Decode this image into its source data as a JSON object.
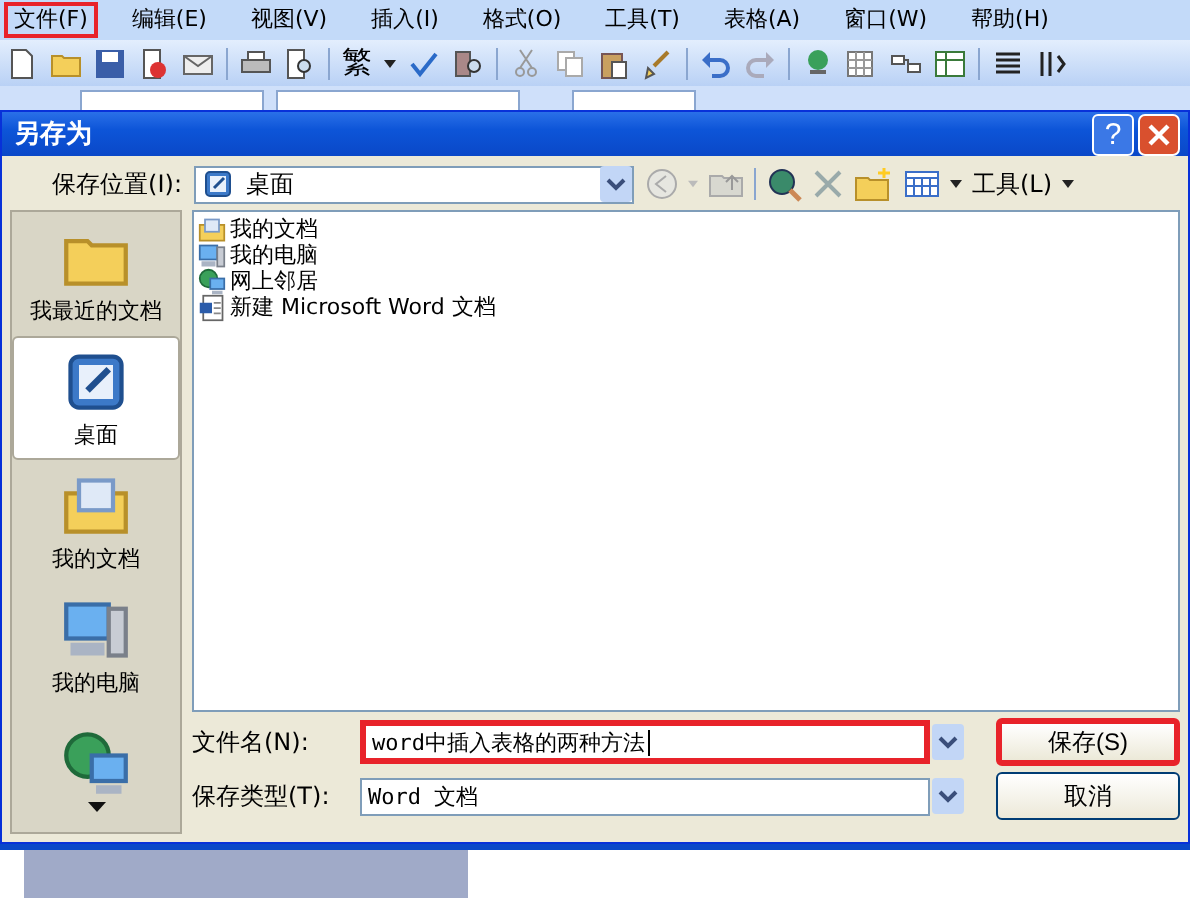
{
  "menu_bar": [
    {
      "label": "文件(F)",
      "highlighted": true
    },
    {
      "label": "编辑(E)",
      "highlighted": false
    },
    {
      "label": "视图(V)",
      "highlighted": false
    },
    {
      "label": "插入(I)",
      "highlighted": false
    },
    {
      "label": "格式(O)",
      "highlighted": false
    },
    {
      "label": "工具(T)",
      "highlighted": false
    },
    {
      "label": "表格(A)",
      "highlighted": false
    },
    {
      "label": "窗口(W)",
      "highlighted": false
    },
    {
      "label": "帮助(H)",
      "highlighted": false
    }
  ],
  "toolbar": {
    "traditional_button": "繁"
  },
  "dialog": {
    "title": "另存为",
    "help_button": "?",
    "save_in": {
      "label": "保存位置(I):",
      "value": "桌面"
    },
    "tools_menu": "工具(L)",
    "places": [
      {
        "label": "我最近的文档",
        "kind": "recent",
        "selected": false
      },
      {
        "label": "桌面",
        "kind": "desktop",
        "selected": true
      },
      {
        "label": "我的文档",
        "kind": "documents",
        "selected": false
      },
      {
        "label": "我的电脑",
        "kind": "computer",
        "selected": false
      },
      {
        "kind": "network",
        "selected": false
      }
    ],
    "files": [
      {
        "name": "我的文档",
        "kind": "documents"
      },
      {
        "name": "我的电脑",
        "kind": "computer"
      },
      {
        "name": "网上邻居",
        "kind": "network"
      },
      {
        "name": "新建 Microsoft Word 文档",
        "kind": "word"
      }
    ],
    "file_name": {
      "label": "文件名(N):",
      "value": "word中插入表格的两种方法",
      "highlighted": true
    },
    "file_type": {
      "label": "保存类型(T):",
      "value": "Word 文档"
    },
    "buttons": [
      {
        "label": "保存(S)",
        "highlighted": true
      },
      {
        "label": "取消",
        "highlighted": false
      }
    ]
  }
}
